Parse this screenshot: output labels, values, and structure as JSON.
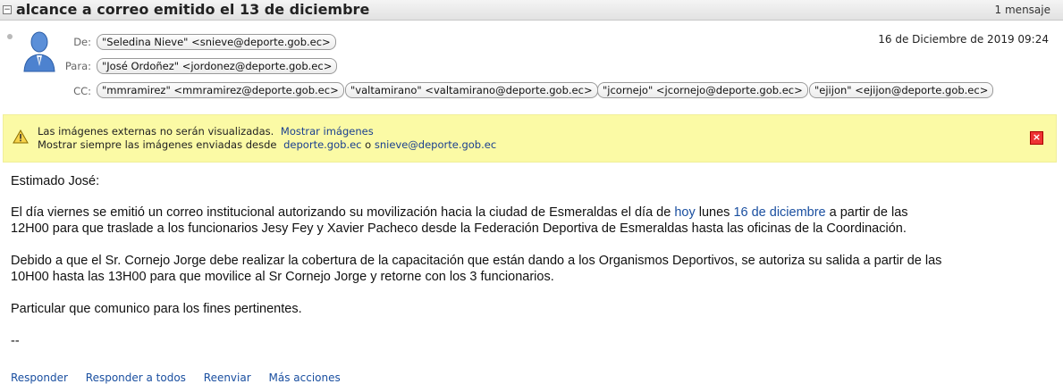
{
  "header": {
    "subject": "alcance a correo emitido el 13 de diciembre",
    "message_count": "1 mensaje",
    "date": "16 de Diciembre de 2019 09:24"
  },
  "fields": {
    "from_label": "De:",
    "to_label": "Para:",
    "cc_label": "CC:",
    "from": "\"Seledina Nieve\" <snieve@deporte.gob.ec>",
    "to": "\"José Ordoñez\" <jordonez@deporte.gob.ec>",
    "cc": [
      "\"mmramirez\" <mmramirez@deporte.gob.ec>",
      "\"valtamirano\" <valtamirano@deporte.gob.ec>",
      "\"jcornejo\" <jcornejo@deporte.gob.ec>",
      "\"ejijon\" <ejijon@deporte.gob.ec>"
    ]
  },
  "banner": {
    "line1_text": "Las imágenes externas no serán visualizadas.",
    "line1_link": "Mostrar imágenes",
    "line2_text": "Mostrar siempre las imágenes enviadas desde",
    "line2_link1": "deporte.gob.ec",
    "line2_or": "o",
    "line2_link2": "snieve@deporte.gob.ec",
    "bg_color": "#fbfaa5"
  },
  "body": {
    "greeting": "Estimado José:",
    "p1_a": "El día viernes se emitió un correo institucional autorizando su movilización hacia la ciudad de Esmeraldas el día de ",
    "p1_link1": "hoy",
    "p1_b": " lunes ",
    "p1_link2": "16 de diciembre",
    "p1_c": " a partir de las",
    "p1_line2": "12H00 para que traslade a los funcionarios Jesy Fey y Xavier Pacheco desde la Federación Deportiva de Esmeraldas hasta las oficinas de la Coordinación.",
    "p2_line1": "Debido a que el Sr. Cornejo Jorge debe realizar la cobertura de la capacitación que están dando a los Organismos Deportivos, se autoriza su salida a partir de las",
    "p2_line2": "10H00 hasta las 13H00 para que movilice al Sr Cornejo Jorge y retorne con los 3 funcionarios.",
    "p3": "Particular que comunico para los fines pertinentes.",
    "signature": "--"
  },
  "actions": [
    "Responder",
    "Responder a todos",
    "Reenviar",
    "Más acciones"
  ],
  "icons": {
    "collapse": "collapse-icon",
    "avatar": "avatar-icon",
    "warning": "warning-icon",
    "close": "close-icon"
  }
}
